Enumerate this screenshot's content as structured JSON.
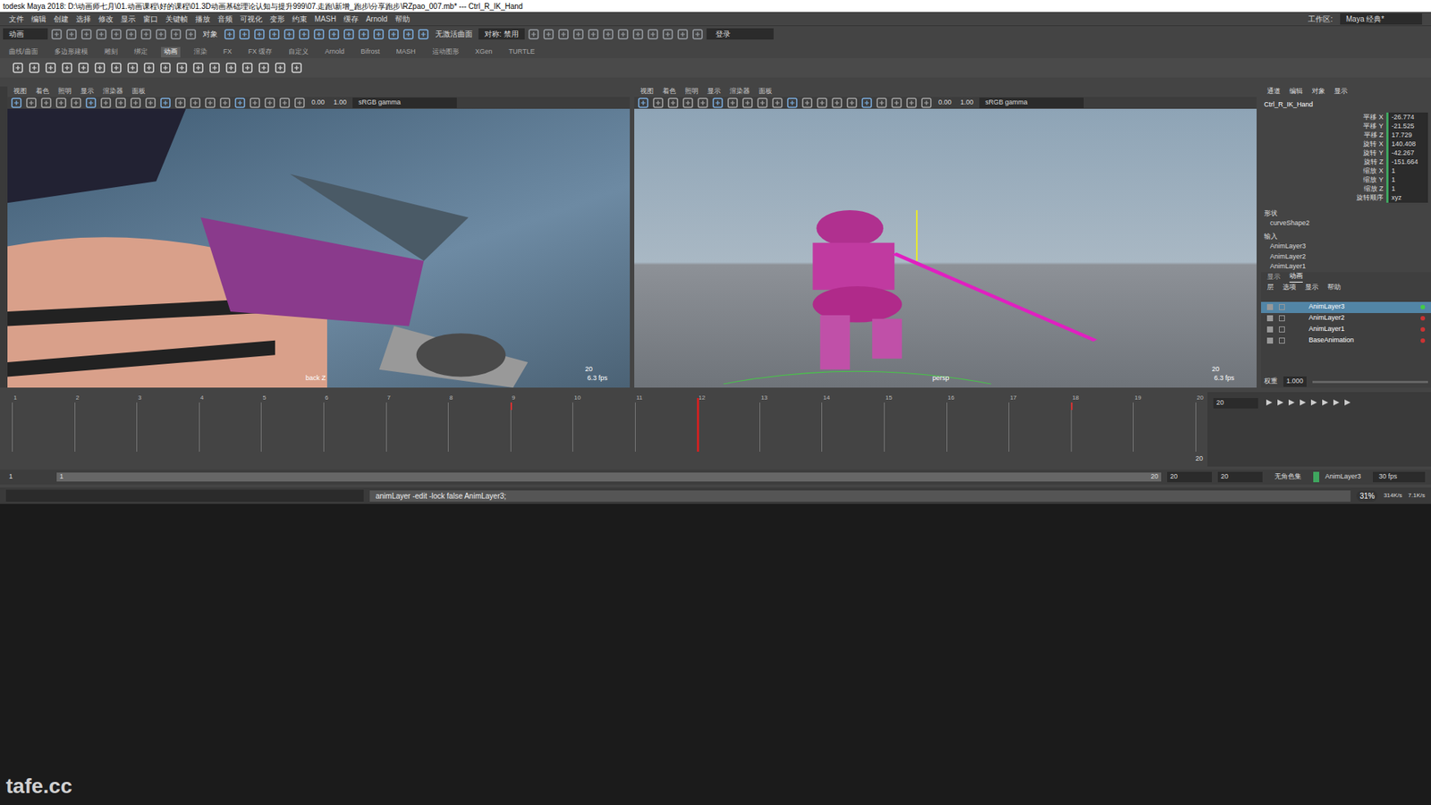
{
  "window": {
    "title": "todesk Maya 2018: D:\\动画师七月\\01.动画课程\\好的课程\\01.3D动画基础理论认知与提升999\\07.走跑\\新增_跑步\\分享跑步\\RZpao_007.mb* --- Ctrl_R_IK_Hand"
  },
  "menubar": {
    "items": [
      "文件",
      "编辑",
      "创建",
      "选择",
      "修改",
      "显示",
      "窗口",
      "关键帧",
      "播放",
      "音频",
      "可视化",
      "变形",
      "约束",
      "MASH",
      "缓存",
      "Arnold",
      "帮助"
    ]
  },
  "statusline": {
    "mode": "动画",
    "object": "对象",
    "surface": "无激活曲面",
    "symmetry": "对称: 禁用",
    "login": "登录",
    "workspace_label": "工作区:",
    "workspace": "Maya 经典*"
  },
  "shelf": {
    "tabs": [
      {
        "label": "曲线/曲面",
        "selected": false
      },
      {
        "label": "多边形建模",
        "selected": false
      },
      {
        "label": "雕刻",
        "selected": false
      },
      {
        "label": "绑定",
        "selected": false
      },
      {
        "label": "动画",
        "selected": true
      },
      {
        "label": "渲染",
        "selected": false
      },
      {
        "label": "FX",
        "selected": false
      },
      {
        "label": "FX 缓存",
        "selected": false
      },
      {
        "label": "自定义",
        "selected": false
      },
      {
        "label": "Arnold",
        "selected": false
      },
      {
        "label": "Bifrost",
        "selected": false
      },
      {
        "label": "MASH",
        "selected": false
      },
      {
        "label": "运动图形",
        "selected": false
      },
      {
        "label": "XGen",
        "selected": false
      },
      {
        "label": "TURTLE",
        "selected": false
      }
    ]
  },
  "viewports": [
    {
      "menus": [
        "视图",
        "着色",
        "照明",
        "显示",
        "渲染器",
        "面板"
      ],
      "values": [
        "0.00",
        "1.00"
      ],
      "colorspace": "sRGB gamma",
      "camera": "back Z",
      "fps": "6.3 fps",
      "frame": "20",
      "kind": "closeup"
    },
    {
      "menus": [
        "视图",
        "着色",
        "照明",
        "显示",
        "渲染器",
        "面板"
      ],
      "values": [
        "0.00",
        "1.00"
      ],
      "colorspace": "sRGB gamma",
      "camera": "persp",
      "fps": "6.3 fps",
      "frame": "20",
      "kind": "persp"
    }
  ],
  "channel_box": {
    "tabs": [
      "通道",
      "编辑",
      "对象",
      "显示"
    ],
    "object": "Ctrl_R_IK_Hand",
    "attributes": [
      {
        "name": "平移 X",
        "value": "-26.774"
      },
      {
        "name": "平移 Y",
        "value": "-21.525"
      },
      {
        "name": "平移 Z",
        "value": "17.729"
      },
      {
        "name": "旋转 X",
        "value": "140.408"
      },
      {
        "name": "旋转 Y",
        "value": "-42.267"
      },
      {
        "name": "旋转 Z",
        "value": "-151.664"
      },
      {
        "name": "缩放 X",
        "value": "1"
      },
      {
        "name": "缩放 Y",
        "value": "1"
      },
      {
        "name": "缩放 Z",
        "value": "1"
      },
      {
        "name": "旋转顺序",
        "value": "xyz"
      }
    ],
    "shapes_label": "形状",
    "shapes": [
      "curveShape2"
    ],
    "inputs_label": "输入",
    "inputs": [
      "AnimLayer3",
      "AnimLayer2",
      "AnimLayer1"
    ]
  },
  "layer_editor": {
    "tabs": [
      {
        "label": "显示",
        "selected": false
      },
      {
        "label": "动画",
        "selected": true
      }
    ],
    "menus": [
      "层",
      "选项",
      "显示",
      "帮助"
    ],
    "layers": [
      {
        "name": "AnimLayer3",
        "selected": true
      },
      {
        "name": "AnimLayer2",
        "selected": false
      },
      {
        "name": "AnimLayer1",
        "selected": false
      },
      {
        "name": "BaseAnimation",
        "selected": false
      }
    ],
    "weight_label": "权重",
    "weight": "1.000"
  },
  "timeline": {
    "ticks": [
      "1",
      "2",
      "3",
      "4",
      "5",
      "6",
      "7",
      "8",
      "9",
      "10",
      "11",
      "12",
      "13",
      "14",
      "15",
      "16",
      "17",
      "18",
      "19",
      "20"
    ],
    "playhead": 12,
    "keys": [
      9,
      18
    ],
    "end_label": "20",
    "current_frame": "20"
  },
  "range": {
    "start": "1",
    "inner_start": "1",
    "inner_end": "20",
    "end": "20",
    "end2": "20",
    "character": "无角色集",
    "layer": "AnimLayer3",
    "fps": "30 fps"
  },
  "command_line": {
    "text": "animLayer -edit -lock false AnimLayer3;"
  },
  "watermark": "tafe.cc",
  "tray": {
    "percent": "31%",
    "up": "314K/s",
    "down": "7.1K/s"
  }
}
